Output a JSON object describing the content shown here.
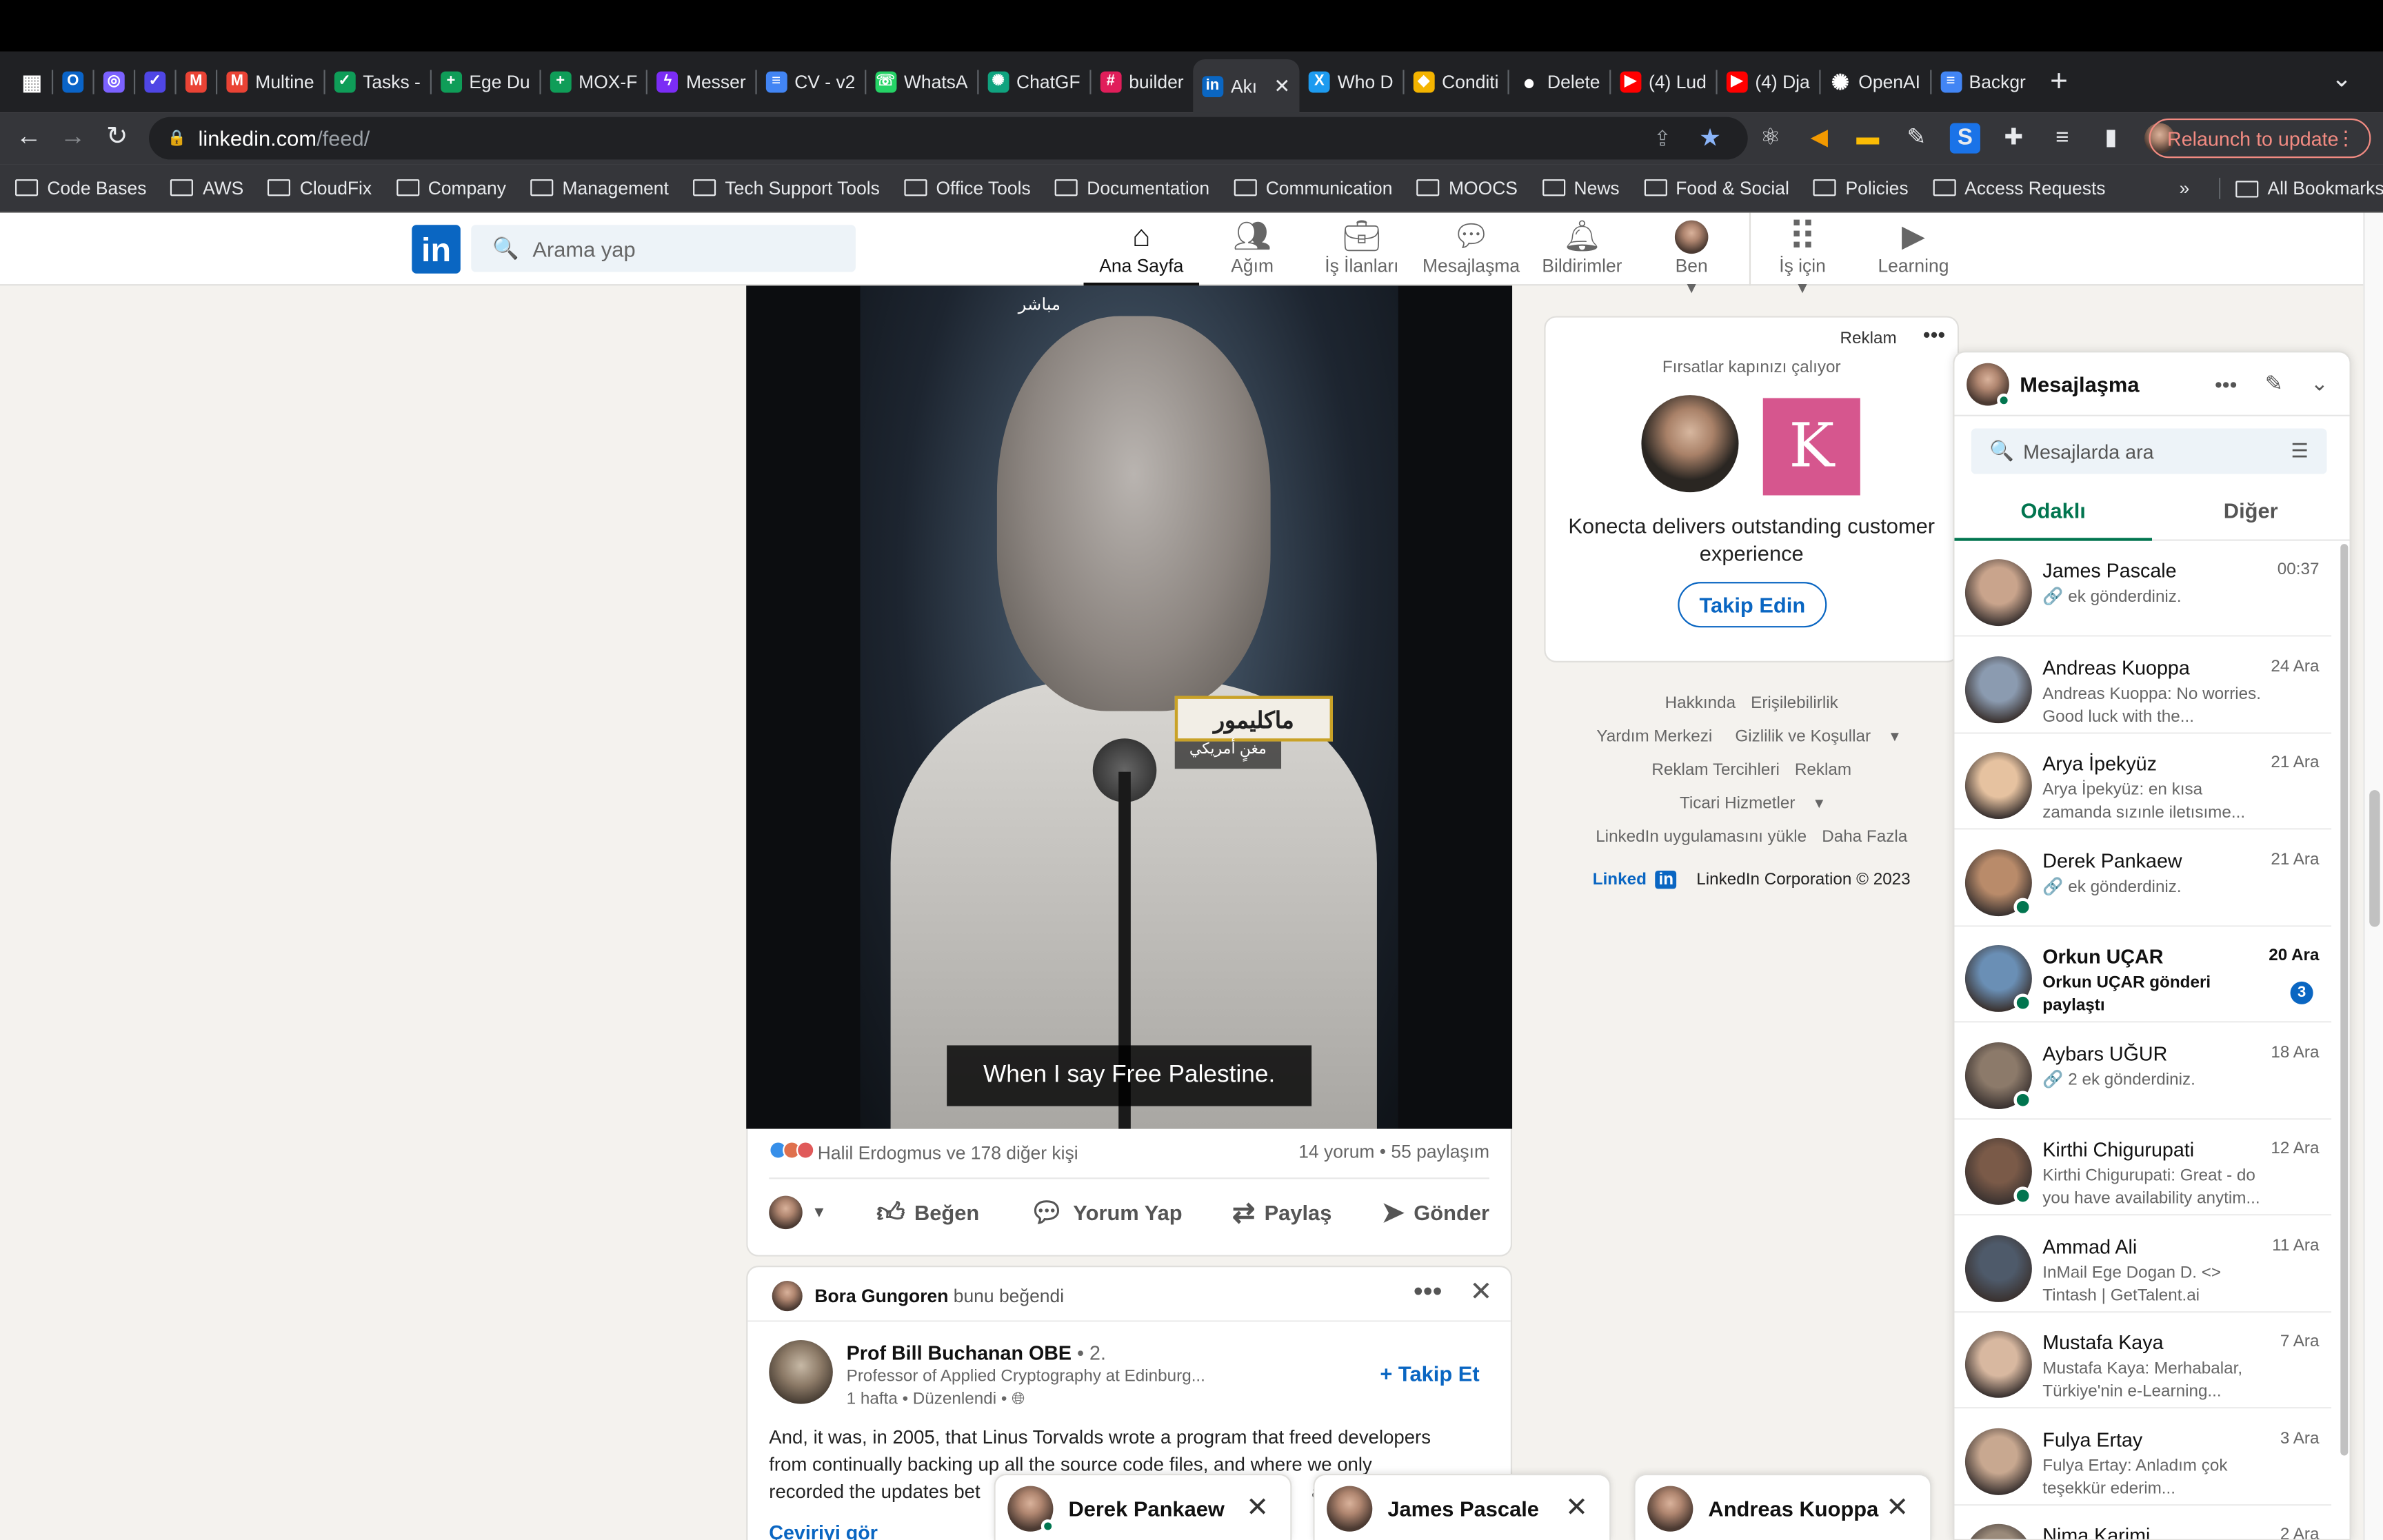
{
  "browser": {
    "tabs": [
      {
        "label": "",
        "color": "#ffffff",
        "icon": "apps-icon"
      },
      {
        "label": "",
        "color": "#0a64c8",
        "icon": "outlook-icon"
      },
      {
        "label": "",
        "color": "#7b61ff",
        "icon": "circle-icon"
      },
      {
        "label": "",
        "color": "#4f46e5",
        "icon": "check-icon"
      },
      {
        "label": "",
        "color": "#ea4335",
        "icon": "gmail-icon"
      },
      {
        "label": "Multine",
        "color": "#ea4335",
        "icon": "gmail-icon"
      },
      {
        "label": "Tasks -",
        "color": "#0f9d58",
        "icon": "tasks-icon"
      },
      {
        "label": "Ege Du",
        "color": "#0f9d58",
        "icon": "sheets-icon"
      },
      {
        "label": "MOX-F",
        "color": "#0f9d58",
        "icon": "sheets-icon"
      },
      {
        "label": "Messer",
        "color": "#7b2cf5",
        "icon": "messenger-icon"
      },
      {
        "label": "CV - v2",
        "color": "#4285f4",
        "icon": "docs-icon"
      },
      {
        "label": "WhatsA",
        "color": "#25d366",
        "icon": "whatsapp-icon"
      },
      {
        "label": "ChatGF",
        "color": "#10a37f",
        "icon": "chatgpt-icon"
      },
      {
        "label": "builder",
        "color": "#e01e5a",
        "icon": "slack-icon"
      },
      {
        "label": "Akı",
        "color": "#0a66c2",
        "icon": "linkedin-icon"
      },
      {
        "label": "Who D",
        "color": "#1d9bf0",
        "icon": "x-icon"
      },
      {
        "label": "Conditi",
        "color": "#f4b400",
        "icon": "condition-icon"
      },
      {
        "label": "Delete",
        "color": "#ffffff",
        "icon": "github-icon"
      },
      {
        "label": "(4) Lud",
        "color": "#ff0000",
        "icon": "youtube-icon"
      },
      {
        "label": "(4) Dja",
        "color": "#ff0000",
        "icon": "youtube-icon"
      },
      {
        "label": "OpenAI",
        "color": "#ffffff",
        "icon": "openai-icon"
      },
      {
        "label": "Backgr",
        "color": "#4285f4",
        "icon": "docs-icon"
      }
    ],
    "active_tab_index": 14,
    "url_domain": "linkedin.com",
    "url_path": "/feed/",
    "relaunch_label": "Relaunch to update",
    "bookmarks": [
      "Code Bases",
      "AWS",
      "CloudFix",
      "Company",
      "Management",
      "Tech Support Tools",
      "Office Tools",
      "Documentation",
      "Communication",
      "MOOCS",
      "News",
      "Food & Social",
      "Policies",
      "Access Requests"
    ],
    "bookmarks_more": "»",
    "all_bookmarks": "All Bookmarks"
  },
  "linkedin": {
    "search_placeholder": "Arama yap",
    "nav": [
      {
        "label": "Ana Sayfa",
        "icon": "home-icon",
        "active": true
      },
      {
        "label": "Ağım",
        "icon": "network-icon",
        "active": false
      },
      {
        "label": "İş İlanları",
        "icon": "briefcase-icon",
        "active": false
      },
      {
        "label": "Mesajlaşma",
        "icon": "messaging-icon",
        "active": false
      },
      {
        "label": "Bildirimler",
        "icon": "bell-icon",
        "active": false
      },
      {
        "label": "Ben",
        "icon": "avatar-icon",
        "active": false
      },
      {
        "label": "İş için",
        "icon": "grid-icon",
        "active": false
      },
      {
        "label": "Learning",
        "icon": "learning-icon",
        "active": false
      }
    ],
    "post": {
      "subtitle_text": "When I say Free Palestine.",
      "overlay_arabic": "ماكليمور",
      "overlay_arabic_sub": "مغنٍ أمريكي",
      "watermark": "مباشر",
      "reactions_text": "Halil Erdogmus ve 178 diğer kişi",
      "comments_shares": "14 yorum • 55 paylaşım",
      "actions": [
        "Beğen",
        "Yorum Yap",
        "Paylaş",
        "Gönder"
      ]
    },
    "post2": {
      "liked_by": "Bora Gungoren",
      "liked_text": "bunu beğendi",
      "author": "Prof Bill Buchanan OBE",
      "degree": "• 2.",
      "headline": "Professor of Applied Cryptography at Edinburg...",
      "meta": "1 hafta • Düzenlendi •",
      "follow": "+ Takip Et",
      "text_line1": "And, it was, in 2005, that Linus Torvalds wrote a program that freed developers",
      "text_line2": "from continually backing up all the source code files, and where we only",
      "text_line3": "recorded the updates bet",
      "text_line3_tail": "an",
      "translate": "Çeviriyi gör"
    },
    "ad": {
      "label": "Reklam",
      "tagline": "Fırsatlar kapınızı çalıyor",
      "logo_letter": "K",
      "text": "Konecta delivers outstanding customer experience",
      "follow": "Takip Edin"
    },
    "footer": {
      "row1": [
        "Hakkında",
        "Erişilebilirlik"
      ],
      "row2": [
        "Yardım Merkezi",
        "Gizlilik ve Koşullar"
      ],
      "row3": [
        "Reklam Tercihleri",
        "Reklam"
      ],
      "row4": [
        "Ticari Hizmetler"
      ],
      "row5": [
        "LinkedIn uygulamasını yükle",
        "Daha Fazla"
      ],
      "brand": "Linked",
      "copyright": "LinkedIn Corporation © 2023"
    },
    "messaging": {
      "title": "Mesajlaşma",
      "search_placeholder": "Mesajlarda ara",
      "tabs": [
        "Odaklı",
        "Diğer"
      ],
      "conversations": [
        {
          "name": "James Pascale",
          "time": "00:37",
          "preview": "🔗 ek gönderdiniz.",
          "online": false,
          "unread": false,
          "badge": ""
        },
        {
          "name": "Andreas Kuoppa",
          "time": "24 Ara",
          "preview": "Andreas Kuoppa: No worries. Good luck with the...",
          "online": false,
          "unread": false,
          "badge": ""
        },
        {
          "name": "Arya İpekyüz",
          "time": "21 Ara",
          "preview": "Arya İpekyüz: en kısa zamanda sızınle iletısıme...",
          "online": false,
          "unread": false,
          "badge": ""
        },
        {
          "name": "Derek Pankaew",
          "time": "21 Ara",
          "preview": "🔗 ek gönderdiniz.",
          "online": true,
          "unread": false,
          "badge": ""
        },
        {
          "name": "Orkun UÇAR",
          "time": "20 Ara",
          "preview": "Orkun UÇAR gönderi paylaştı",
          "online": true,
          "unread": true,
          "badge": "3"
        },
        {
          "name": "Aybars UĞUR",
          "time": "18 Ara",
          "preview": "🔗 2 ek gönderdiniz.",
          "online": true,
          "unread": false,
          "badge": ""
        },
        {
          "name": "Kirthi Chigurupati",
          "time": "12 Ara",
          "preview": "Kirthi Chigurupati: Great - do you have availability anytim...",
          "online": true,
          "unread": false,
          "badge": ""
        },
        {
          "name": "Ammad Ali",
          "time": "11 Ara",
          "preview": "InMail Ege Dogan D. <> Tintash | GetTalent.ai",
          "online": false,
          "unread": false,
          "badge": ""
        },
        {
          "name": "Mustafa Kaya",
          "time": "7 Ara",
          "preview": "Mustafa Kaya: Merhabalar, Türkiye'nin e-Learning...",
          "online": false,
          "unread": false,
          "badge": ""
        },
        {
          "name": "Fulya Ertay",
          "time": "3 Ara",
          "preview": "Fulya Ertay: Anladım çok teşekkür ederim...",
          "online": false,
          "unread": false,
          "badge": ""
        },
        {
          "name": "Nima Karimi",
          "time": "2 Ara",
          "preview": "",
          "online": false,
          "unread": false,
          "badge": ""
        }
      ]
    },
    "chat_windows": [
      "Derek Pankaew",
      "James Pascale",
      "Andreas Kuoppa"
    ]
  }
}
